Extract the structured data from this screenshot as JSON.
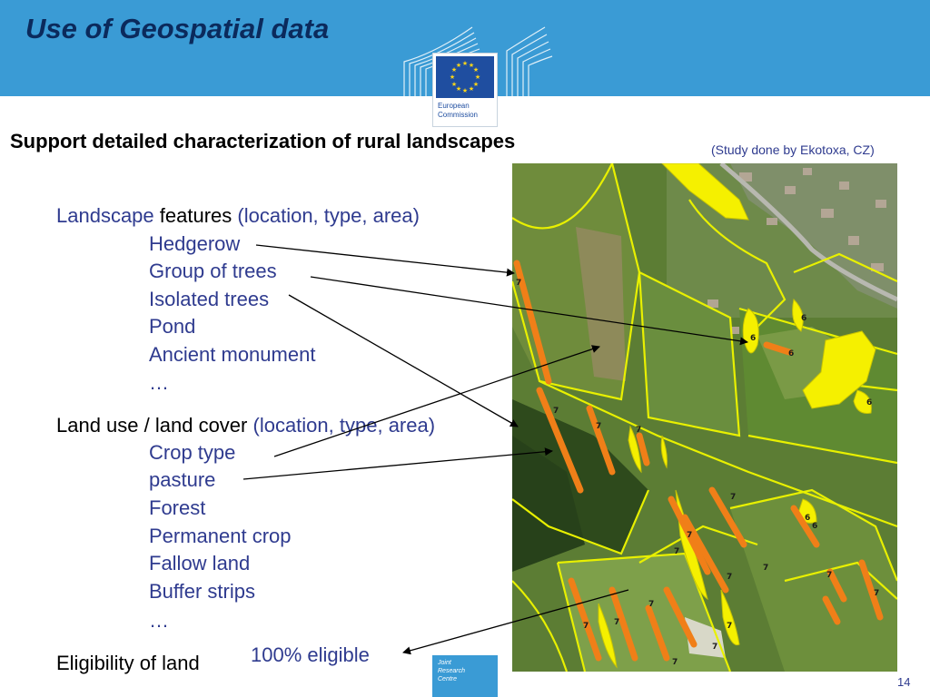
{
  "header": {
    "title": "Use of Geospatial data"
  },
  "logo_top": {
    "line1": "European",
    "line2": "Commission"
  },
  "subtitle": "Support detailed characterization of rural landscapes",
  "credit": "(Study done by Ekotoxa, CZ)",
  "landscape": {
    "heading_a": "Landscape",
    "heading_b": "features",
    "heading_c": "(location, type, area)",
    "items": [
      "Hedgerow",
      "Group of trees",
      "Isolated trees",
      "Pond",
      "Ancient monument",
      "…"
    ]
  },
  "landuse": {
    "heading_a": "Land use / land cover",
    "heading_b": "(location, type, area)",
    "items": [
      "Crop type",
      "pasture",
      "Forest",
      "Permanent crop",
      "Fallow land",
      "Buffer strips",
      "…"
    ]
  },
  "eligibility": {
    "label": "Eligibility of land",
    "value": "100% eligible"
  },
  "map_labels": [
    "7",
    "6"
  ],
  "logo_bottom": {
    "line1": "Joint",
    "line2": "Research",
    "line3": "Centre"
  },
  "page_number": "14",
  "colors": {
    "header": "#3a9bd5",
    "accent_text": "#2f3b8f",
    "hedgerow": "#f07f18",
    "tree_group": "#f5f000",
    "boundary": "#e8f000"
  }
}
